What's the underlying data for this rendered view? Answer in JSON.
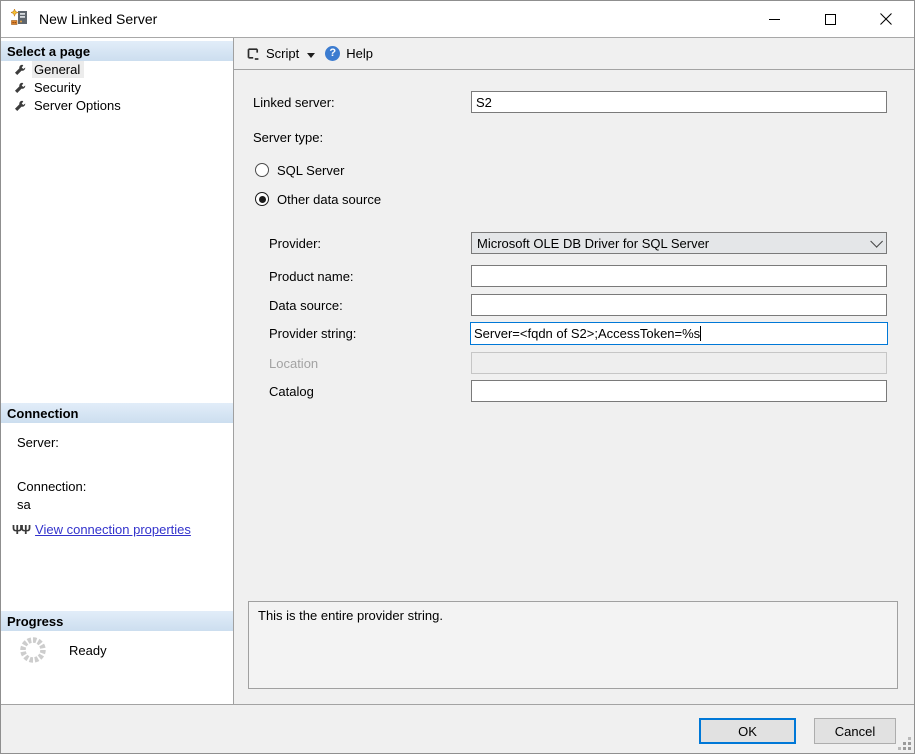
{
  "window": {
    "title": "New Linked Server"
  },
  "toolbar": {
    "script_label": "Script",
    "help_label": "Help"
  },
  "sidebar": {
    "select_page": {
      "header": "Select a page",
      "items": [
        {
          "label": "General",
          "selected": true
        },
        {
          "label": "Security",
          "selected": false
        },
        {
          "label": "Server Options",
          "selected": false
        }
      ]
    },
    "connection": {
      "header": "Connection",
      "server_label": "Server:",
      "server_value": "",
      "connection_label": "Connection:",
      "connection_value": "sa",
      "link_label": "View connection properties"
    },
    "progress": {
      "header": "Progress",
      "status": "Ready"
    }
  },
  "form": {
    "linked_server_label": "Linked server:",
    "linked_server_value": "S2",
    "server_type_label": "Server type:",
    "server_types": [
      {
        "label": "SQL Server",
        "selected": false
      },
      {
        "label": "Other data source",
        "selected": true
      }
    ],
    "provider_label": "Provider:",
    "provider_value": "Microsoft OLE DB Driver for SQL Server",
    "product_name_label": "Product name:",
    "product_name_value": "",
    "data_source_label": "Data source:",
    "data_source_value": "",
    "provider_string_label": "Provider string:",
    "provider_string_value": "Server=<fqdn of S2>;AccessToken=%s",
    "location_label": "Location",
    "location_value": "",
    "location_disabled": true,
    "catalog_label": "Catalog",
    "catalog_value": "",
    "help_text": "This is the entire provider string."
  },
  "footer": {
    "ok_label": "OK",
    "cancel_label": "Cancel"
  },
  "icons": {
    "help_glyph": "?",
    "connection_glyph": "ΨΨ"
  },
  "colors": {
    "accent_blue": "#0078d7",
    "link_blue": "#3333cc",
    "help_icon_blue": "#3c7cd0",
    "panel_grey": "#f0f0f0",
    "sidebar_header_top": "#e2edf9",
    "sidebar_header_bottom": "#ccdeef"
  }
}
